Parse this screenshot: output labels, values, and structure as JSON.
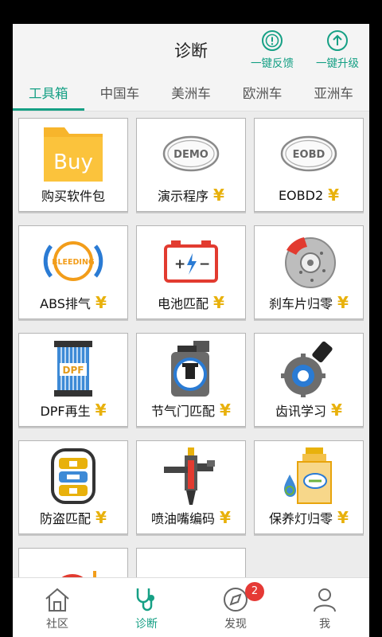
{
  "header": {
    "title": "诊断",
    "feedback_label": "一键反馈",
    "upgrade_label": "一键升级"
  },
  "tabs": [
    {
      "label": "工具箱"
    },
    {
      "label": "中国车"
    },
    {
      "label": "美洲车"
    },
    {
      "label": "欧洲车"
    },
    {
      "label": "亚洲车"
    }
  ],
  "cards": [
    {
      "label": "购买软件包",
      "icon": "buy-folder-icon",
      "icon_text": "Buy",
      "priced": false
    },
    {
      "label": "演示程序",
      "icon": "demo-badge-icon",
      "icon_text": "DEMO",
      "priced": true
    },
    {
      "label": "EOBD2",
      "icon": "eobd-badge-icon",
      "icon_text": "EOBD",
      "priced": true
    },
    {
      "label": "ABS排气",
      "icon": "abs-bleeding-icon",
      "icon_text": "BLEEDING",
      "priced": true
    },
    {
      "label": "电池匹配",
      "icon": "battery-icon",
      "priced": true
    },
    {
      "label": "刹车片归零",
      "icon": "brake-disc-icon",
      "priced": true
    },
    {
      "label": "DPF再生",
      "icon": "dpf-filter-icon",
      "icon_text": "DPF",
      "priced": true
    },
    {
      "label": "节气门匹配",
      "icon": "throttle-icon",
      "priced": true
    },
    {
      "label": "齿讯学习",
      "icon": "gear-sensor-icon",
      "priced": true
    },
    {
      "label": "防盗匹配",
      "icon": "car-key-icon",
      "priced": true
    },
    {
      "label": "喷油嘴编码",
      "icon": "injector-icon",
      "priced": true
    },
    {
      "label": "保养灯归零",
      "icon": "oil-service-icon",
      "priced": true
    },
    {
      "label": "",
      "icon": "partial-gauge-icon",
      "priced": false
    },
    {
      "label": "",
      "icon": "partial-steering-icon",
      "priced": false
    }
  ],
  "price_symbol": "¥",
  "bottom_nav": [
    {
      "label": "社区",
      "icon": "home-icon"
    },
    {
      "label": "诊断",
      "icon": "stethoscope-icon"
    },
    {
      "label": "发现",
      "icon": "compass-icon",
      "badge": "2"
    },
    {
      "label": "我",
      "icon": "user-icon"
    }
  ],
  "colors": {
    "accent": "#16a085",
    "price": "#e8b10c",
    "badge": "#e53935"
  }
}
